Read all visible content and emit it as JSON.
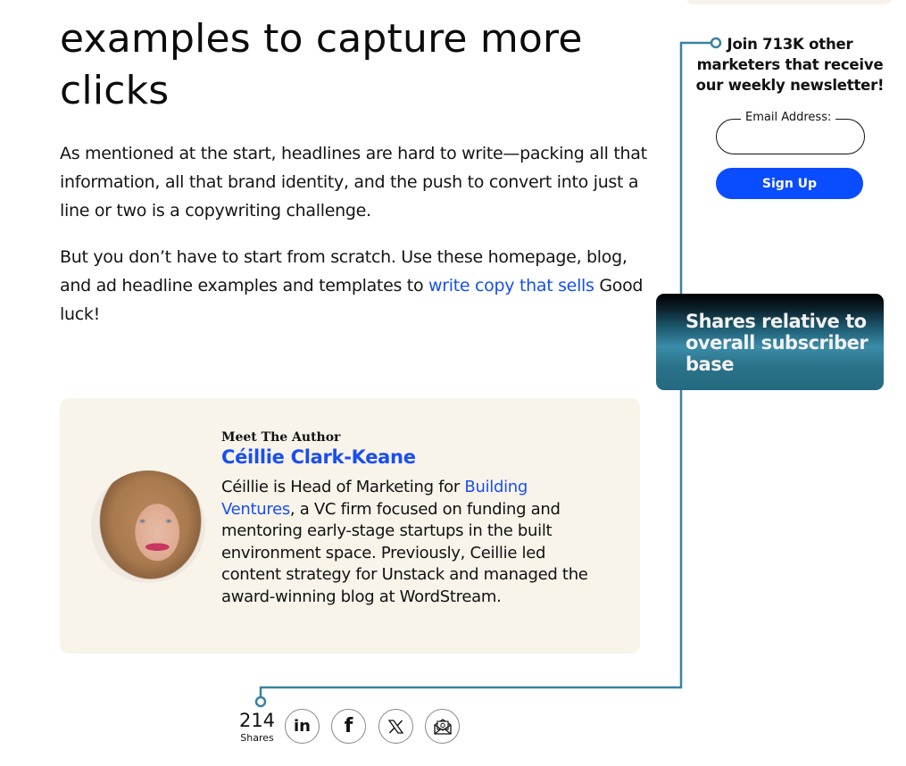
{
  "article": {
    "headline": "examples to capture more clicks",
    "paragraph1": "As mentioned at the start, headlines are hard to write—packing all that information, all that brand identity, and the push to convert into just a line or two is a copywriting challenge.",
    "paragraph2_before_link": "But you don’t have to start from scratch. Use these homepage, blog, and ad headline examples and templates to ",
    "paragraph2_link": "write copy that sells",
    "paragraph2_after_link": " Good luck!"
  },
  "newsletter": {
    "text": "Join 713K other marketers that receive our weekly newsletter!",
    "email_label": "Email Address:",
    "email_value": "",
    "signup_label": "Sign Up"
  },
  "tooltip": {
    "text": "Shares relative to overall subscriber base"
  },
  "author": {
    "section_label": "Meet The Author",
    "name": "Céillie Clark-Keane",
    "bio_before_link": "Céillie is Head of Marketing for ",
    "bio_link": "Building Ventures",
    "bio_after_link": ", a VC firm focused on funding and mentoring early-stage startups in the built environment space. Previously, Ceillie led content strategy for Unstack and managed the award-winning blog at WordStream."
  },
  "shares": {
    "count": "214",
    "label": "Shares",
    "buttons": [
      {
        "name": "linkedin",
        "glyph": "in",
        "icon": "linkedin-icon"
      },
      {
        "name": "facebook",
        "glyph": "f",
        "icon": "facebook-icon"
      },
      {
        "name": "x",
        "glyph": "𝕏",
        "icon": "x-icon"
      },
      {
        "name": "email",
        "glyph": "",
        "icon": "email-icon"
      }
    ]
  },
  "colors": {
    "link": "#1350f0",
    "signup_button": "#0a4cff",
    "connector_line": "#3a82a0",
    "card_background": "#f8f4ea"
  }
}
